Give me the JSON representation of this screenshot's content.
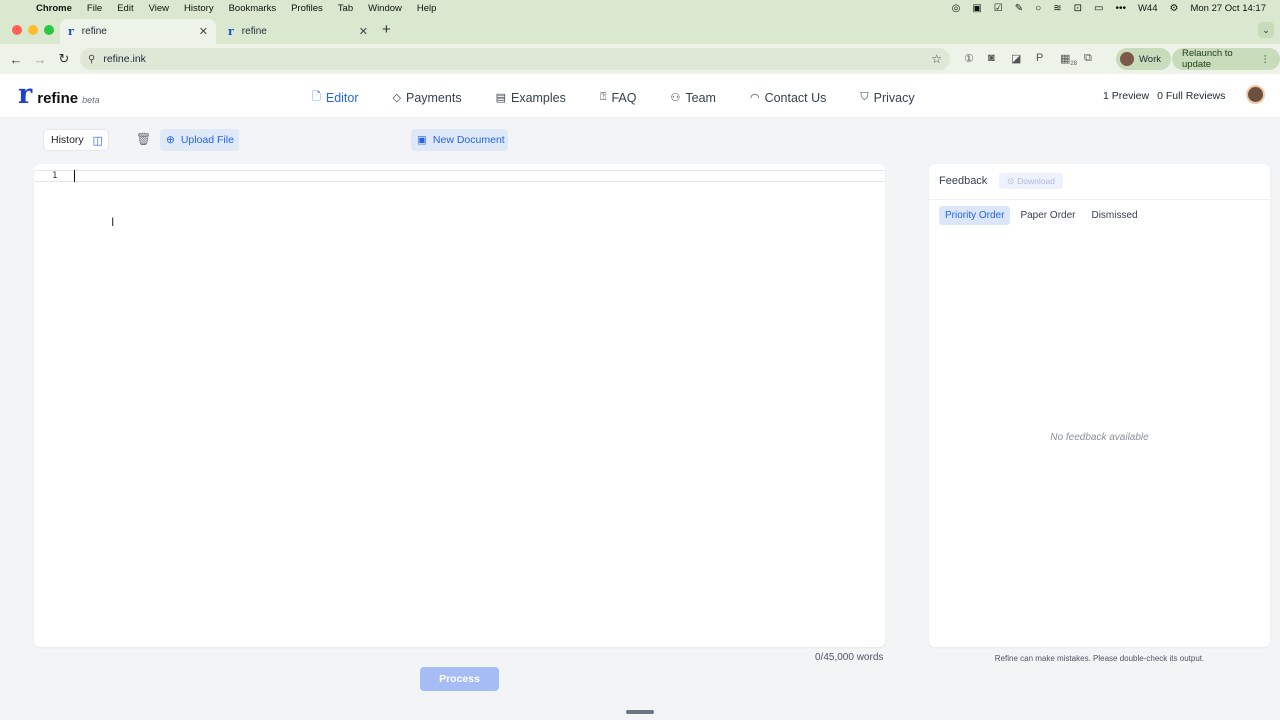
{
  "menubar": {
    "app": "Chrome",
    "items": [
      "File",
      "Edit",
      "View",
      "History",
      "Bookmarks",
      "Profiles",
      "Tab",
      "Window",
      "Help"
    ],
    "week": "W44",
    "datetime": "Mon 27 Oct  14:17"
  },
  "browser": {
    "tabs": [
      {
        "title": "refine",
        "active": true
      },
      {
        "title": "refine",
        "active": false
      }
    ],
    "url": "refine.ink",
    "profile": "Work",
    "relaunch": "Relaunch to update",
    "extension_badge": "28"
  },
  "site": {
    "logo_mark": "r",
    "brand": "refine",
    "beta": "beta",
    "nav": [
      {
        "label": "Editor",
        "icon": "document-icon",
        "active": true
      },
      {
        "label": "Payments",
        "icon": "tag-icon"
      },
      {
        "label": "Examples",
        "icon": "archive-icon"
      },
      {
        "label": "FAQ",
        "icon": "question-icon"
      },
      {
        "label": "Team",
        "icon": "users-icon"
      },
      {
        "label": "Contact Us",
        "icon": "headset-icon"
      },
      {
        "label": "Privacy",
        "icon": "shield-icon"
      }
    ],
    "reviews": {
      "preview": "1 Preview",
      "full": "0 Full Reviews"
    }
  },
  "toolbar": {
    "history": "History",
    "upload": "Upload File",
    "new_document": "New Document"
  },
  "editor": {
    "line_number": "1",
    "word_count": "0/45,000 words",
    "process": "Process"
  },
  "feedback": {
    "title": "Feedback",
    "download": "Download",
    "tabs": [
      "Priority Order",
      "Paper Order",
      "Dismissed"
    ],
    "empty": "No feedback available",
    "disclaimer": "Refine can make mistakes. Please double-check its output."
  }
}
